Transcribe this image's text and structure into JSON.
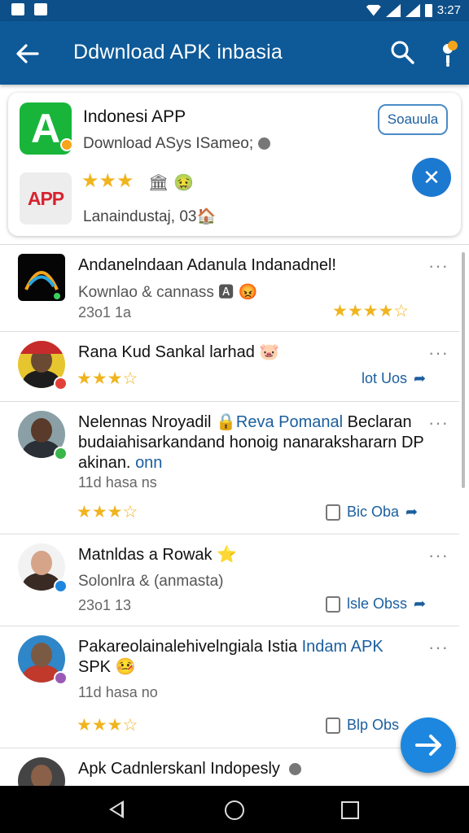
{
  "status_bar": {
    "time": "3:27"
  },
  "app_bar": {
    "title": "Ddwnload APK inbasia"
  },
  "featured": {
    "app_name": "Indonesi APP",
    "subtitle": "Download ASys ISameo;",
    "subscribe_label": "Soauula",
    "icon_b_text": "APP",
    "rating": 2.5,
    "stars_text": "★★★",
    "extra": "🏛 🤢",
    "meta": "Lanaindustaj, 03🏠"
  },
  "items": [
    {
      "title": "Andanelndaan Adanula Indanadnel!",
      "sub": "Kownlao & cannass 🅰 😡",
      "date": "23o1 1a",
      "stars": "★★★★☆",
      "more": "···"
    },
    {
      "title": "Rana Kud Sankal larhad 🐷",
      "stars": "★★★☆",
      "action": "lot Uos",
      "more": "···"
    },
    {
      "title_a": "Nelennas Nroyadil",
      "title_link": "Reva Pomanal",
      "title_b": "Beclaran budaiahisarkandand honoig nanarakshararn DP akinan.",
      "title_link2": "onn",
      "date": "11d hasa ns",
      "stars": "★★★☆",
      "action": "Bic Oba",
      "more": "···"
    },
    {
      "title": "Matnldas a Rowak ⭐",
      "sub": "Solonlra & (anmasta)",
      "date": "23o1 13",
      "action": "lsle Obss",
      "more": "···"
    },
    {
      "title_a": "Pakareolainalehivelngiala Istia",
      "title_link": "Indam APK",
      "title_b": "SPK 🤒",
      "date": "11d hasa no",
      "stars": "★★★☆",
      "action": "Blp Obs",
      "more": "···"
    },
    {
      "title": "Apk Cadnlerskanl Indopesly",
      "sub": "..."
    }
  ],
  "icons": {
    "back": "arrow-left-icon",
    "search": "search-icon",
    "notification": "notification-icon",
    "share": "share-icon",
    "send_fab": "send-icon"
  },
  "colors": {
    "app_bar": "#0e5a98",
    "accent": "#1d87df",
    "star": "#f0b41e",
    "link": "#1b5e9e"
  }
}
